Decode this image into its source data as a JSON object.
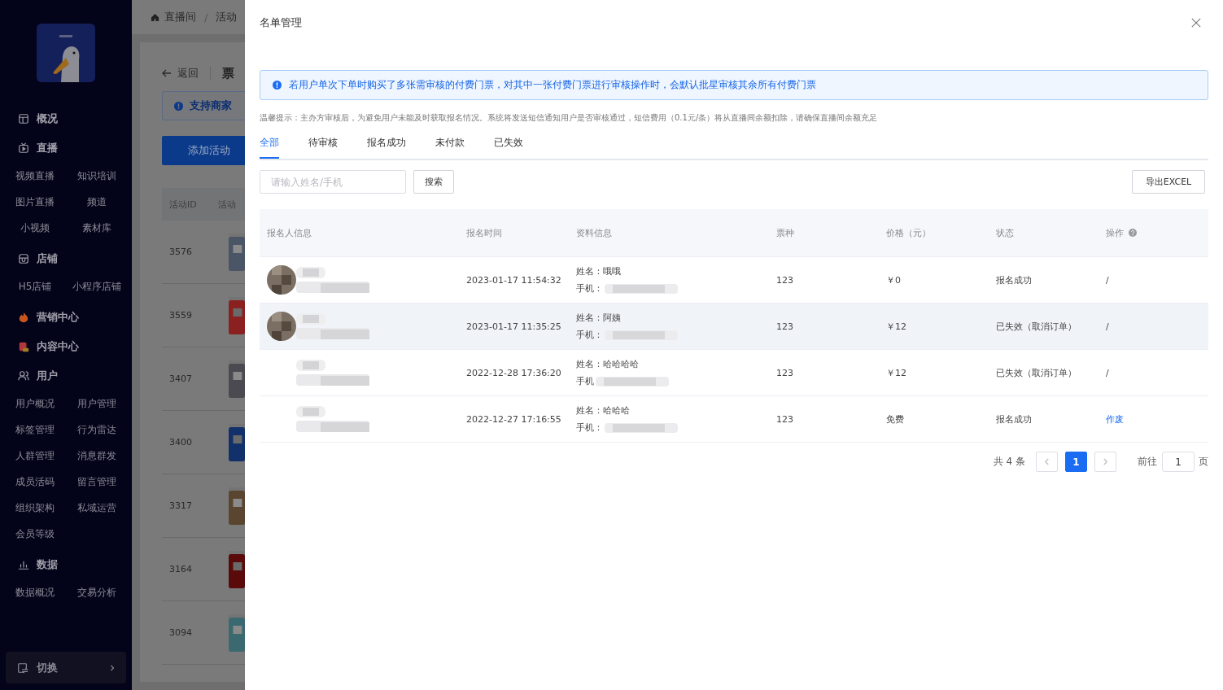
{
  "sidebar": {
    "sections": [
      {
        "label": "概况"
      },
      {
        "label": "直播",
        "children": [
          "视频直播",
          "知识培训",
          "图片直播",
          "频道",
          "小视频",
          "素材库"
        ]
      },
      {
        "label": "店铺",
        "children": [
          "H5店铺",
          "小程序店铺"
        ]
      },
      {
        "label": "营销中心"
      },
      {
        "label": "内容中心"
      },
      {
        "label": "用户",
        "children": [
          "用户概况",
          "用户管理",
          "标签管理",
          "行为雷达",
          "人群管理",
          "消息群发",
          "成员活码",
          "留言管理",
          "组织架构",
          "私域运营",
          "会员等级"
        ]
      },
      {
        "label": "数据",
        "children": [
          "数据概况",
          "交易分析"
        ]
      }
    ],
    "switch_button": "切换"
  },
  "background": {
    "breadcrumb": [
      "直播间",
      "活动"
    ],
    "breadcrumb_separator": "/",
    "back": "返回",
    "title": "票",
    "alert": "支持商家",
    "add_button": "添加活动",
    "columns": [
      "活动ID",
      "活动"
    ],
    "rows": [
      "3576",
      "3559",
      "3407",
      "3400",
      "3317",
      "3164",
      "3094"
    ]
  },
  "drawer": {
    "title": "名单管理",
    "notice": "若用户单次下单时购买了多张需审核的付费门票，对其中一张付费门票进行审核操作时，会默认批星审核其余所有付费门票",
    "tip": "温馨提示：主办方审核后，为避免用户未能及时获取报名情况。系统将发送短信通知用户是否审核通过，短信费用（0.1元/条）将从直播间余额扣除，请确保直播间余额充足",
    "tabs": [
      {
        "label": "全部",
        "selected": true
      },
      {
        "label": "待审核",
        "selected": false
      },
      {
        "label": "报名成功",
        "selected": false
      },
      {
        "label": "未付款",
        "selected": false
      },
      {
        "label": "已失效",
        "selected": false
      }
    ],
    "search": {
      "placeholder": "请输入姓名/手机"
    },
    "search_button": "搜索",
    "export_button": "导出EXCEL",
    "table": {
      "columns": [
        "报名人信息",
        "报名时间",
        "资料信息",
        "票种",
        "价格（元）",
        "状态",
        "操作"
      ],
      "rows": [
        {
          "avatar": true,
          "hovered": false,
          "time": "2023-01-17 11:54:32",
          "name_label": "姓名：",
          "name": "哦哦",
          "phone_label": "手机：",
          "ticket": "123",
          "price": "￥0",
          "status": "报名成功",
          "action": {
            "kind": "text",
            "text": "/"
          }
        },
        {
          "avatar": true,
          "hovered": true,
          "time": "2023-01-17 11:35:25",
          "name_label": "姓名：",
          "name": "阿姨",
          "phone_label": "手机：",
          "ticket": "123",
          "price": "￥12",
          "status": "已失效（取消订单）",
          "action": {
            "kind": "text",
            "text": "/"
          }
        },
        {
          "avatar": false,
          "hovered": false,
          "time": "2022-12-28 17:36:20",
          "name_label": "姓名：",
          "name": "哈哈哈哈",
          "phone_label": "手机",
          "ticket": "123",
          "price": "￥12",
          "status": "已失效（取消订单）",
          "action": {
            "kind": "text",
            "text": "/"
          }
        },
        {
          "avatar": false,
          "hovered": false,
          "time": "2022-12-27 17:16:55",
          "name_label": "姓名：",
          "name": "哈哈哈",
          "phone_label": "手机：",
          "ticket": "123",
          "price": "免费",
          "status": "报名成功",
          "action": {
            "kind": "link",
            "text": "作废"
          }
        }
      ]
    },
    "pagination": {
      "total": "共 4 条",
      "pages": [
        {
          "label": "1",
          "selected": true
        }
      ],
      "goto_label": "前往",
      "goto_value": "1",
      "page_suffix": "页"
    }
  }
}
